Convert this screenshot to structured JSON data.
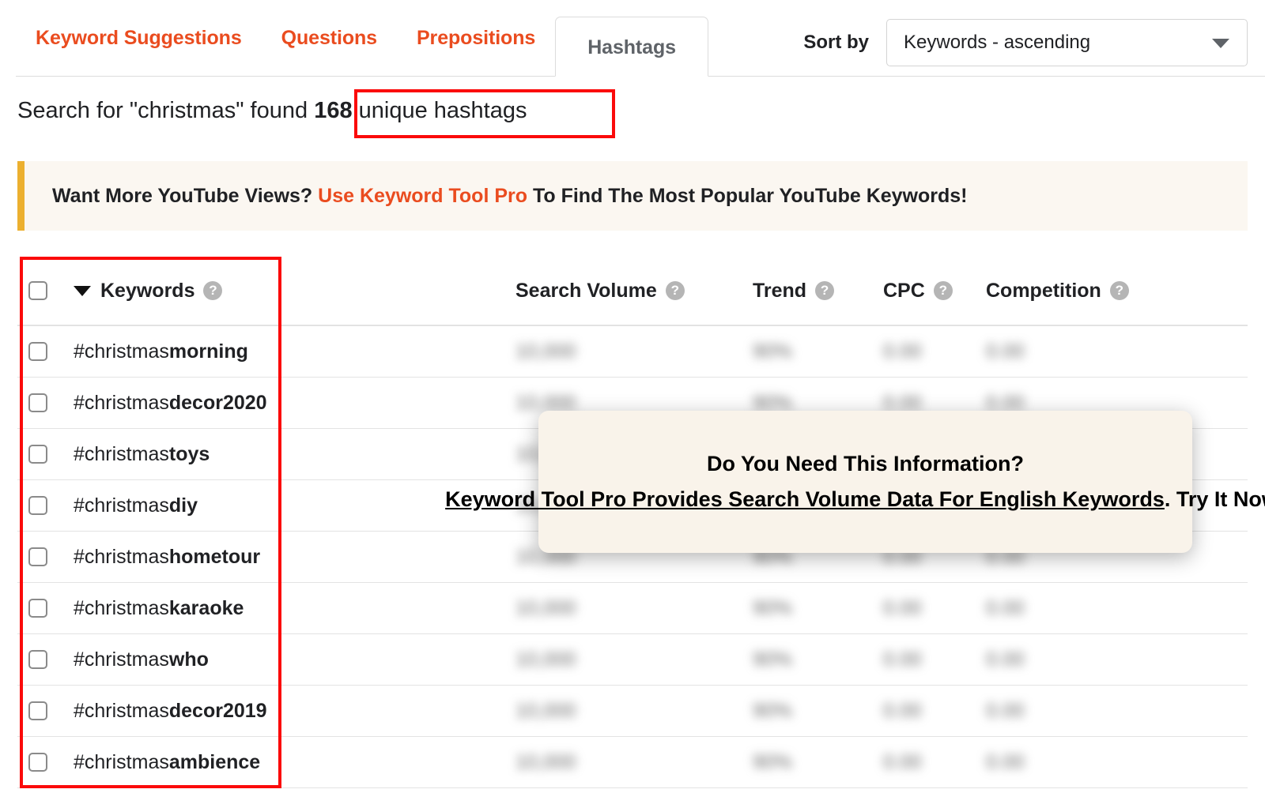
{
  "tabs": [
    {
      "label": "Keyword Suggestions",
      "active": false
    },
    {
      "label": "Questions",
      "active": false
    },
    {
      "label": "Prepositions",
      "active": false
    },
    {
      "label": "Hashtags",
      "active": true
    }
  ],
  "sort": {
    "label": "Sort by",
    "value": "Keywords - ascending",
    "caret_icon": "chevron-down-icon"
  },
  "result": {
    "prefix": "Search for \"christmas\" found ",
    "count": "168",
    "suffix": " unique hashtags"
  },
  "promo": {
    "before": "Want More YouTube Views? ",
    "link": "Use Keyword Tool Pro",
    "after": " To Find The Most Popular YouTube Keywords!"
  },
  "table": {
    "columns": [
      {
        "label": "Keywords",
        "help_icon": "question-mark-icon",
        "sort_icon": "sort-descending-caret-icon"
      },
      {
        "label": "Search Volume",
        "help_icon": "question-mark-icon"
      },
      {
        "label": "Trend",
        "help_icon": "question-mark-icon"
      },
      {
        "label": "CPC",
        "help_icon": "question-mark-icon"
      },
      {
        "label": "Competition",
        "help_icon": "question-mark-icon"
      }
    ],
    "rows": [
      {
        "prefix": "#christmas",
        "suffix": "morning",
        "search_volume": "10,000",
        "trend": "90%",
        "cpc": "0.00",
        "competition": "0.00"
      },
      {
        "prefix": "#christmas",
        "suffix": "decor2020",
        "search_volume": "10,000",
        "trend": "90%",
        "cpc": "0.00",
        "competition": "0.00"
      },
      {
        "prefix": "#christmas",
        "suffix": "toys",
        "search_volume": "10,000",
        "trend": "90%",
        "cpc": "0.00",
        "competition": "0.00"
      },
      {
        "prefix": "#christmas",
        "suffix": "diy",
        "search_volume": "10,000",
        "trend": "90%",
        "cpc": "0.00",
        "competition": "0.00"
      },
      {
        "prefix": "#christmas",
        "suffix": "hometour",
        "search_volume": "10,000",
        "trend": "90%",
        "cpc": "0.00",
        "competition": "0.00"
      },
      {
        "prefix": "#christmas",
        "suffix": "karaoke",
        "search_volume": "10,000",
        "trend": "90%",
        "cpc": "0.00",
        "competition": "0.00"
      },
      {
        "prefix": "#christmas",
        "suffix": "who",
        "search_volume": "10,000",
        "trend": "90%",
        "cpc": "0.00",
        "competition": "0.00"
      },
      {
        "prefix": "#christmas",
        "suffix": "decor2019",
        "search_volume": "10,000",
        "trend": "90%",
        "cpc": "0.00",
        "competition": "0.00"
      },
      {
        "prefix": "#christmas",
        "suffix": "ambience",
        "search_volume": "10,000",
        "trend": "90%",
        "cpc": "0.00",
        "competition": "0.00"
      }
    ]
  },
  "tooltip": {
    "line1": "Do You Need This Information?",
    "line2_link": "Keyword Tool Pro Provides Search Volume Data For English Keywords",
    "line2_tail": ". Try It Now!"
  },
  "annotations": {
    "highlight_color": "#fb0a0a",
    "boxes": [
      "result-count-box",
      "keywords-column-box"
    ]
  },
  "colors": {
    "accent": "#ea4c1f",
    "banner_bg": "#fbf7f1",
    "banner_bar": "#ecb02f",
    "tooltip_bg": "#f9f3ea"
  }
}
